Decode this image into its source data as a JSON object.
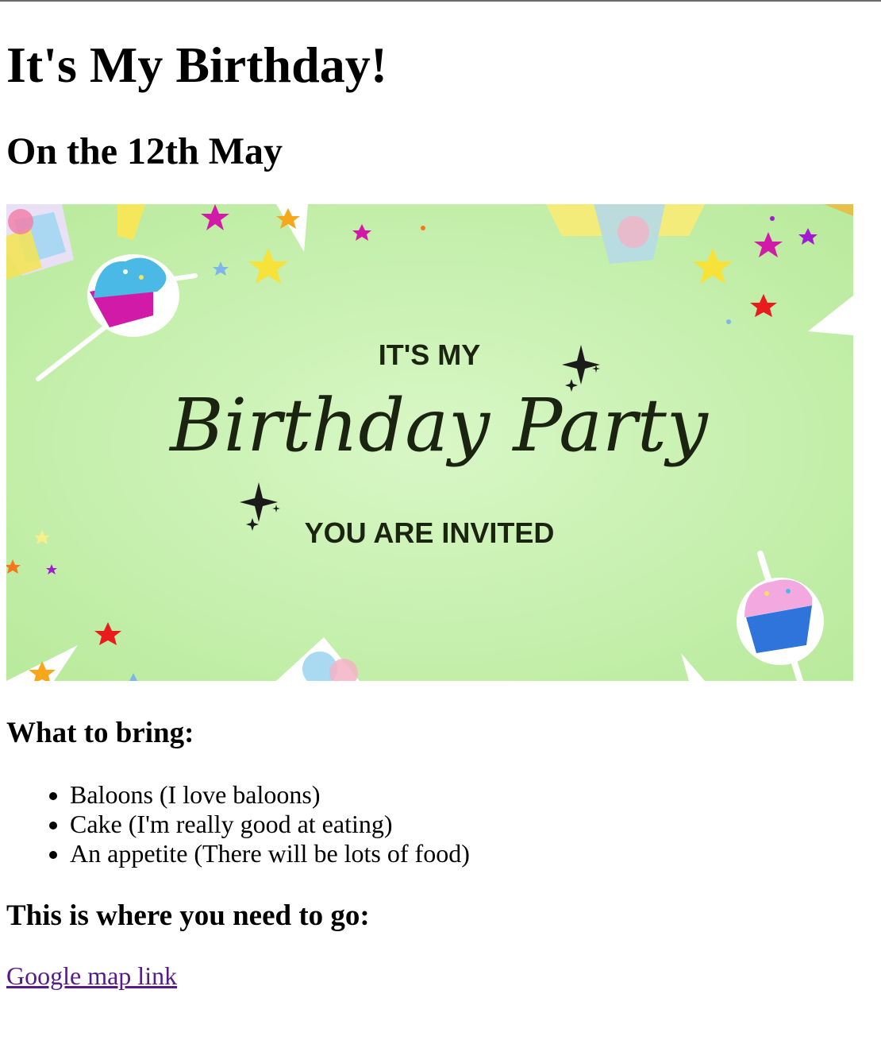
{
  "page": {
    "title": "It's My Birthday!",
    "date_heading": "On the 12th May"
  },
  "banner": {
    "top_line": "IT'S MY",
    "script_title": "Birthday Party",
    "bottom_line": "YOU ARE INVITED",
    "colors": {
      "background": "#c9f0b4",
      "text": "#1b2410"
    }
  },
  "bring": {
    "heading": "What to bring:",
    "items": [
      "Baloons (I love baloons)",
      "Cake (I'm really good at eating)",
      "An appetite (There will be lots of food)"
    ]
  },
  "directions": {
    "heading": "This is where you need to go:",
    "link_text": "Google map link"
  }
}
